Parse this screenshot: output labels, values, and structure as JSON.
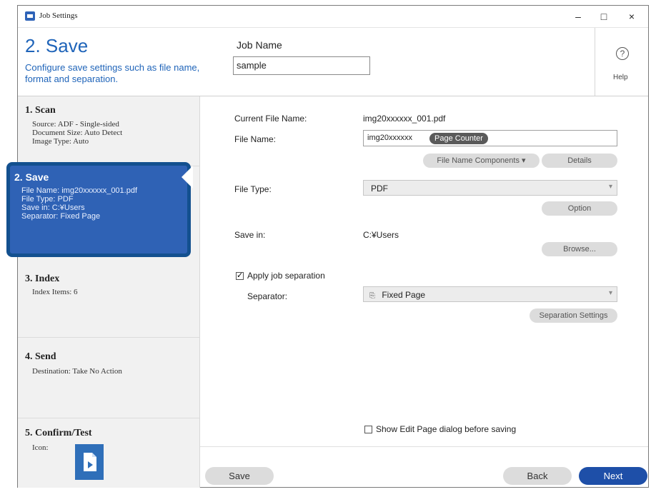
{
  "window": {
    "title": "Job Settings",
    "minimize": "–",
    "maximize": "□",
    "close": "×"
  },
  "header": {
    "step_title": "2. Save",
    "step_desc": "Configure save settings such as file name, format and separation.",
    "job_name_label": "Job Name",
    "job_name_value": "sample",
    "help_icon": "?",
    "help_label": "Help"
  },
  "sidebar": {
    "items": [
      {
        "title": "1. Scan",
        "details": [
          "Source: ADF - Single-sided",
          "Document Size: Auto Detect",
          "Image Type: Auto"
        ]
      },
      {
        "title": "2. Save",
        "details": [
          "File Name: img20xxxxxx_001.pdf",
          "File Type: PDF",
          "Save in: C:¥Users",
          "Separator: Fixed Page"
        ]
      },
      {
        "title": "3. Index",
        "details": [
          "Index Items: 6"
        ]
      },
      {
        "title": "4. Send",
        "details": [
          "Destination: Take No Action"
        ]
      },
      {
        "title": "5. Confirm/Test",
        "details": [
          "Icon:"
        ]
      }
    ]
  },
  "main": {
    "current_file_name_label": "Current File Name:",
    "current_file_name_value": "img20xxxxxx_001.pdf",
    "file_name_label": "File Name:",
    "file_name_text": "img20xxxxxx",
    "file_name_token": "Page Counter",
    "file_name_components_btn": "File Name Components ▾",
    "details_btn": "Details",
    "file_type_label": "File Type:",
    "file_type_value": "PDF",
    "option_btn": "Option",
    "save_in_label": "Save in:",
    "save_in_value": "C:¥Users",
    "browse_btn": "Browse...",
    "apply_separation_label": "Apply job separation",
    "separator_label": "Separator:",
    "separator_value": "Fixed Page",
    "separation_settings_btn": "Separation Settings",
    "show_edit_page_label": "Show Edit Page dialog before saving"
  },
  "footer": {
    "save_btn": "Save",
    "back_btn": "Back",
    "next_btn": "Next"
  },
  "colors": {
    "accent": "#1f64b9",
    "active_step": "#2f62b5",
    "next_button": "#1e4fa8"
  }
}
